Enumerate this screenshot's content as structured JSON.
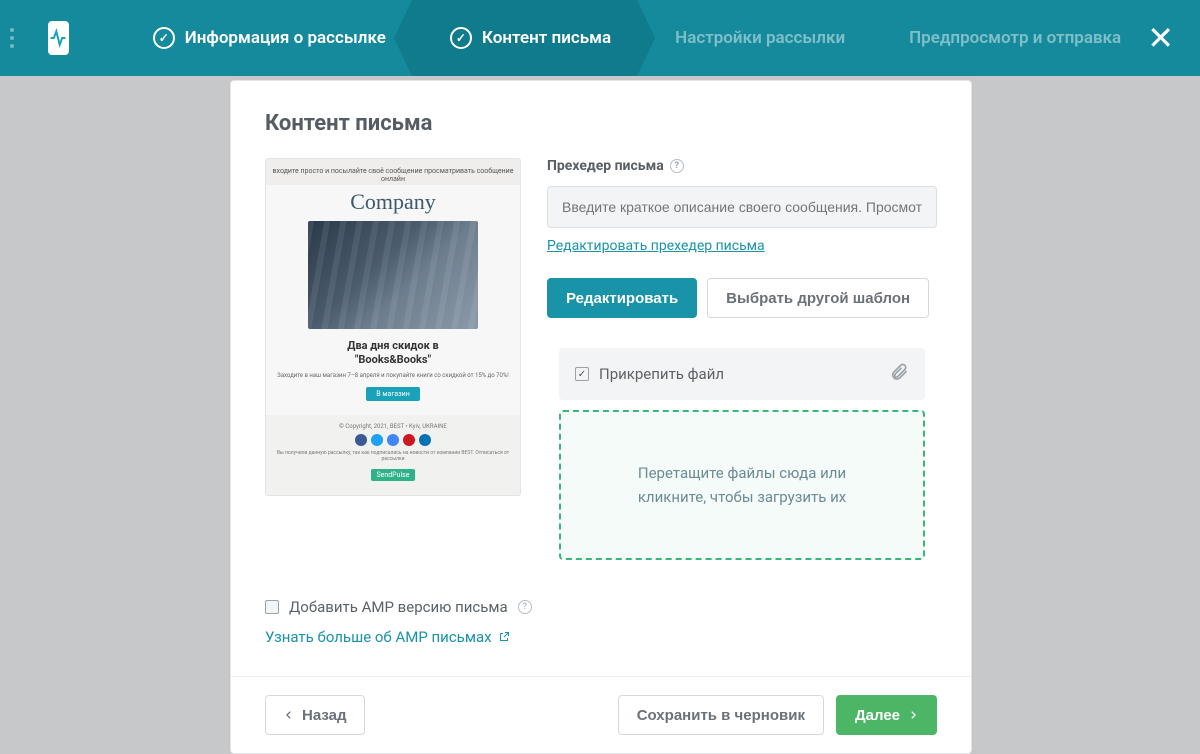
{
  "wizard": {
    "steps": [
      {
        "label": "Информация о рассылке",
        "state": "done"
      },
      {
        "label": "Контент письма",
        "state": "active"
      },
      {
        "label": "Настройки рассылки",
        "state": "pending"
      },
      {
        "label": "Предпросмотр и отправка",
        "state": "pending"
      }
    ]
  },
  "page_title": "Контент письма",
  "preview": {
    "logo_text": "Company",
    "headline_line1": "Два дня скидок в",
    "headline_line2": "\"Books&Books\"",
    "subline": "Заходите в наш магазин 7–8 апреля и покупайте книги со скидкой от 15% до 70%!",
    "cta": "В магазин",
    "copyright": "© Copyright, 2021, BEST • Kyiv, UKRAINE",
    "caption_bottom": "Вы получили данную рассылку, так как подписались на новости от компании BEST. Отписаться от рассылки",
    "tag": "SendPulse"
  },
  "preheader": {
    "label": "Прехедер письма",
    "placeholder": "Введите краткое описание своего сообщения. Просмотр",
    "edit_link": "Редактировать прехедер письма"
  },
  "actions": {
    "edit": "Редактировать",
    "choose_template": "Выбрать другой шаблон"
  },
  "attach": {
    "checked": true,
    "label": "Прикрепить файл",
    "dropzone_line1": "Перетащите файлы сюда или",
    "dropzone_line2": "кликните, чтобы загрузить их"
  },
  "amp": {
    "checkbox_label": "Добавить AMP версию письма",
    "learn_more": "Узнать больше об AMP письмах"
  },
  "footer": {
    "back": "Назад",
    "save_draft": "Сохранить в черновик",
    "next": "Далее"
  }
}
